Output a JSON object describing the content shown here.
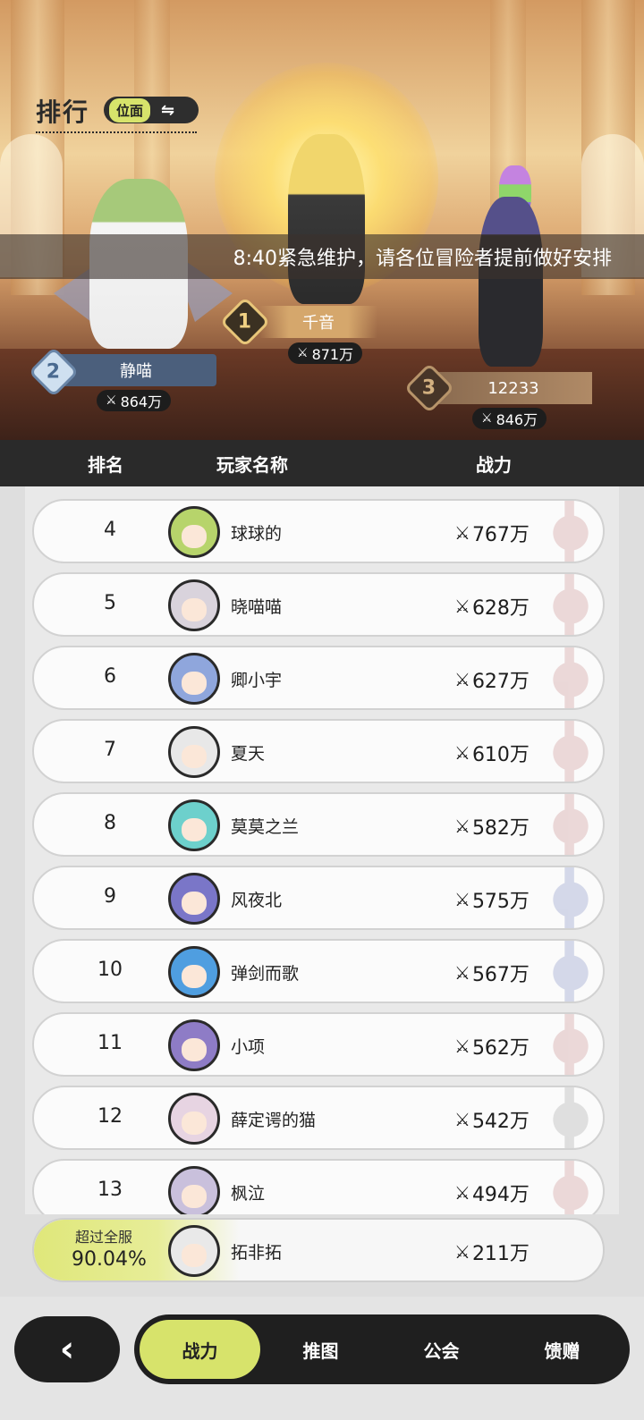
{
  "header": {
    "title": "排行",
    "realm_toggle_label": "位面",
    "swap_icon": "swap-arrows-icon"
  },
  "notice": "8:40紧急维护，请各位冒险者提前做好安排",
  "podium": {
    "first": {
      "rank": "1",
      "name": "千音",
      "power": "871万"
    },
    "second": {
      "rank": "2",
      "name": "静喵",
      "power": "864万"
    },
    "third": {
      "rank": "3",
      "name": "12233",
      "power": "846万"
    }
  },
  "columns": {
    "rank": "排名",
    "name": "玩家名称",
    "power": "战力"
  },
  "rows": [
    {
      "rank": "4",
      "name": "球球的",
      "power": "767万",
      "avatar_color": "#b7d46b",
      "emblem_color": "#b35a5a"
    },
    {
      "rank": "5",
      "name": "晓喵喵",
      "power": "628万",
      "avatar_color": "#d9d3dc",
      "emblem_color": "#b35a5a"
    },
    {
      "rank": "6",
      "name": "卿小宇",
      "power": "627万",
      "avatar_color": "#8fa6dc",
      "emblem_color": "#b35a5a"
    },
    {
      "rank": "7",
      "name": "夏天",
      "power": "610万",
      "avatar_color": "#e8e8e8",
      "emblem_color": "#b35a5a"
    },
    {
      "rank": "8",
      "name": "莫莫之兰",
      "power": "582万",
      "avatar_color": "#6dd0cc",
      "emblem_color": "#b35a5a"
    },
    {
      "rank": "9",
      "name": "风夜北",
      "power": "575万",
      "avatar_color": "#7a76c8",
      "emblem_color": "#4a5aa8"
    },
    {
      "rank": "10",
      "name": "弹剑而歌",
      "power": "567万",
      "avatar_color": "#4f9ee0",
      "emblem_color": "#4a5aa8"
    },
    {
      "rank": "11",
      "name": "小项",
      "power": "562万",
      "avatar_color": "#8e7cc6",
      "emblem_color": "#b35a5a"
    },
    {
      "rank": "12",
      "name": "薛定谔的猫",
      "power": "542万",
      "avatar_color": "#e7d4e2",
      "emblem_color": "#7a7a7a"
    },
    {
      "rank": "13",
      "name": "枫泣",
      "power": "494万",
      "avatar_color": "#c9c0dc",
      "emblem_color": "#b35a5a"
    }
  ],
  "me": {
    "surpass_label": "超过全服",
    "surpass_value": "90.04%",
    "name": "拓非拓",
    "power": "211万",
    "avatar_color": "#e9e9e9"
  },
  "tabs": [
    "战力",
    "推图",
    "公会",
    "馈赠"
  ],
  "active_tab": "战力",
  "colors": {
    "accent": "#d7e36b",
    "dark": "#1f1f1f"
  }
}
